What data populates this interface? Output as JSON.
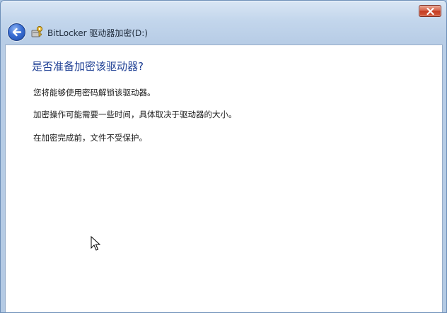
{
  "window": {
    "title": "BitLocker 驱动器加密(D:)",
    "back_button": "back-arrow-icon",
    "close_button": "close-icon",
    "app_icon": "bitlocker-key-icon",
    "accent_color": "#1e3f94",
    "close_color": "#c43b22"
  },
  "page": {
    "title": "是否准备加密该驱动器?",
    "lines": [
      "您将能够使用密码解锁该驱动器。",
      "加密操作可能需要一些时间，具体取决于驱动器的大小。",
      "在加密完成前，文件不受保护。"
    ]
  }
}
